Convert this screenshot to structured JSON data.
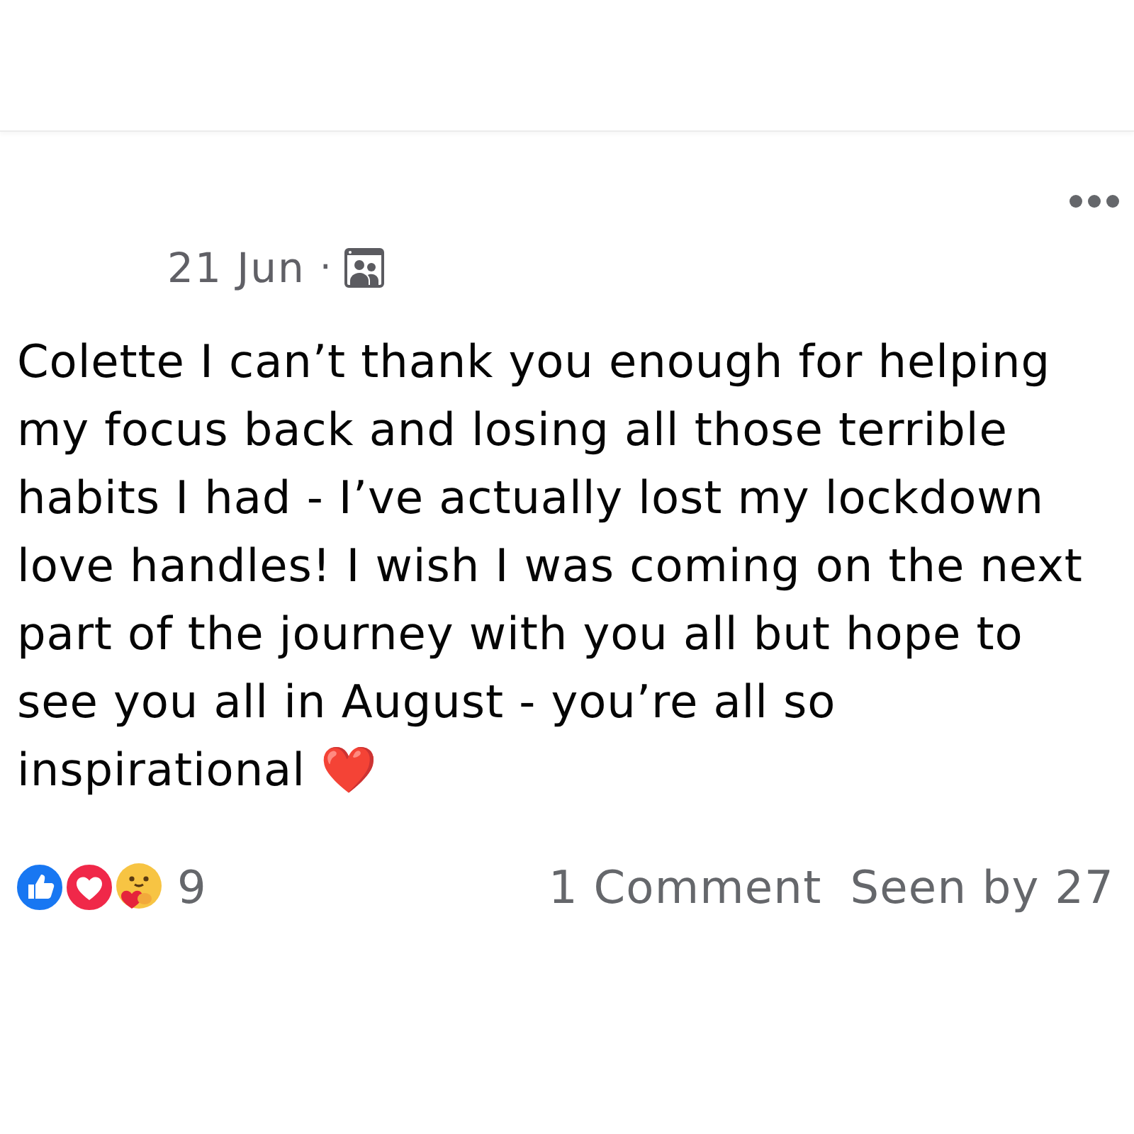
{
  "post": {
    "date": "21 Jun",
    "separator": "·",
    "text": "Colette I can’t thank you enough for helping my focus back and losing all those terrible habits I had - I’ve actually lost my lockdown love handles! I wish I was coming on the next part of the journey with you all but hope to see you all in August - you’re all so inspirational ❤️",
    "reactions": [
      {
        "kind": "like"
      },
      {
        "kind": "love"
      },
      {
        "kind": "care"
      }
    ],
    "reaction_count": "9",
    "comments": "1 Comment",
    "seen_by": "Seen by 27"
  }
}
